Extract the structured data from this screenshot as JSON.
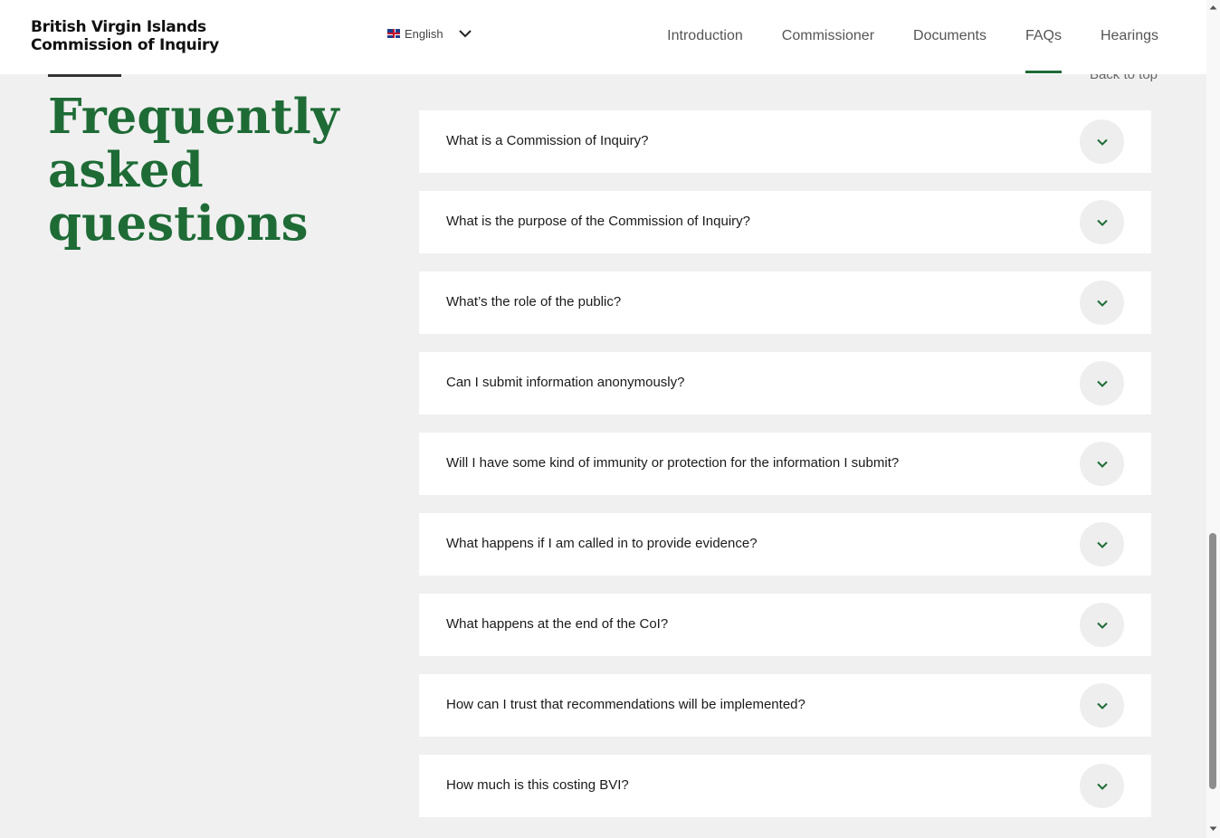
{
  "header": {
    "logo_line1": "British Virgin Islands",
    "logo_line2": "Commission of Inquiry",
    "language": "English",
    "nav": [
      {
        "label": "Introduction"
      },
      {
        "label": "Commissioner"
      },
      {
        "label": "Documents"
      },
      {
        "label": "FAQs"
      },
      {
        "label": "Hearings"
      }
    ],
    "active_nav": "FAQs"
  },
  "main": {
    "heading": "Frequently asked questions",
    "back_to_top": "Back to top",
    "faqs": [
      {
        "question": "What is a Commission of Inquiry?"
      },
      {
        "question": "What is the purpose of the Commission of Inquiry?"
      },
      {
        "question": "What’s the role of the public?"
      },
      {
        "question": "Can I submit information anonymously?"
      },
      {
        "question": "Will I have some kind of immunity or protection for the information I submit?"
      },
      {
        "question": "What happens if I am called in to provide evidence?"
      },
      {
        "question": "What happens at the end of the CoI?"
      },
      {
        "question": "How can I trust that recommendations will be implemented?"
      },
      {
        "question": "How much is this costing BVI?"
      }
    ]
  },
  "colors": {
    "brand_green": "#1e6b36",
    "page_background": "#f0f0f0"
  },
  "icons": {
    "language_toggle": "chevron-down-icon",
    "faq_toggle": "chevron-down-icon",
    "flag": "uk-flag-icon"
  }
}
